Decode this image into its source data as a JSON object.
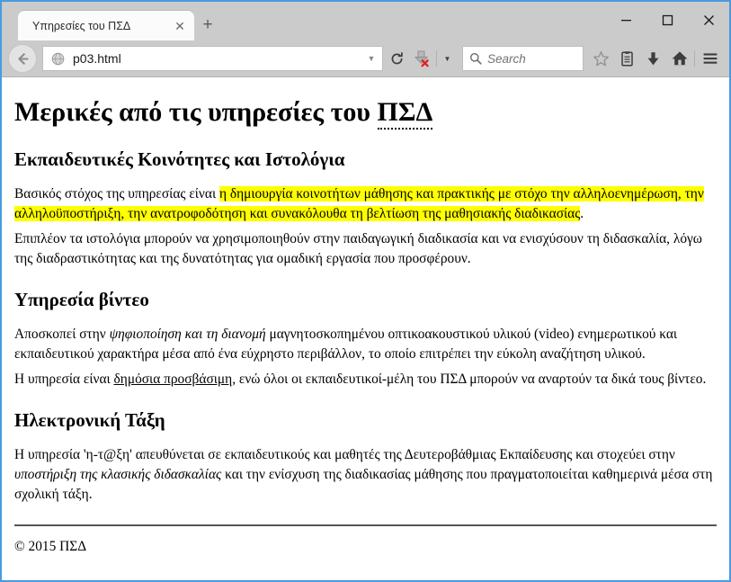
{
  "window": {
    "controls": {
      "minimize": "—",
      "maximize": "☐",
      "close": "✕"
    }
  },
  "tabs": [
    {
      "title": "Υπηρεσίες του ΠΣΔ",
      "close_label": "✕"
    }
  ],
  "newtab_label": "+",
  "toolbar": {
    "back_icon": "back-arrow-icon",
    "reload_icon": "reload-icon",
    "url": "p03.html",
    "url_dropdown_icon": "chevron-down-icon",
    "favicon": "globe-icon",
    "plugin_icon": "download-blocked-icon",
    "plugin_caret_icon": "chevron-down-icon",
    "search_placeholder": "Search",
    "search_icon": "search-icon",
    "bookmark_icon": "star-icon",
    "reader_icon": "reader-list-icon",
    "downloads_icon": "download-arrow-icon",
    "home_icon": "home-icon",
    "menu_icon": "hamburger-menu-icon"
  },
  "page": {
    "h1_before": "Μερικές από τις υπηρεσίες του ",
    "h1_abbr": "ΠΣΔ",
    "section1": {
      "heading": "Εκπαιδευτικές Κοινότητες και Ιστολόγια",
      "p1_before": "Βασικός στόχος της υπηρεσίας είναι ",
      "p1_mark": "η δημιουργία κοινοτήτων μάθησης και πρακτικής με στόχο την αλληλοενημέρωση, την αλληλοϋποστήριξη, την ανατροφοδότηση και συνακόλουθα τη βελτίωση της μαθησιακής διαδικασίας",
      "p1_after": ".",
      "p2": "Επιπλέον τα ιστολόγια μπορούν να χρησιμοποιηθούν στην παιδαγωγική διαδικασία και να ενισχύσουν τη διδασκαλία, λόγω της διαδραστικότητας και της δυνατότητας για ομαδική εργασία που προσφέρουν."
    },
    "section2": {
      "heading": "Υπηρεσία βίντεο",
      "p1_before": "Αποσκοπεί στην ",
      "p1_em": "ψηφιοποίηση και τη διανομή",
      "p1_after": " μαγνητοσκοπημένου οπτικοακουστικού υλικού (video) ενημερωτικού και εκπαιδευτικού χαρακτήρα μέσα από ένα εύχρηστο περιβάλλον, το οποίο επιτρέπει την εύκολη αναζήτηση υλικού.",
      "p2_before": "Η υπηρεσία είναι ",
      "p2_ins": "δημόσια προσβάσιμη",
      "p2_after": ", ενώ όλοι οι εκπαιδευτικοί-μέλη του ΠΣΔ μπορούν να αναρτούν τα δικά τους βίντεο."
    },
    "section3": {
      "heading": "Ηλεκτρονική Τάξη",
      "p1_before": "Η υπηρεσία 'η-τ@ξη' απευθύνεται σε εκπαιδευτικούς και μαθητές της Δευτεροβάθμιας Εκπαίδευσης και στοχεύει στην ",
      "p1_em": "υποστήριξη της κλασικής διδασκαλίας",
      "p1_after": " και την ενίσχυση της διαδικασίας μάθησης που πραγματοποιείται καθημερινά μέσα στη σχολική τάξη."
    },
    "footer": "© 2015 ΠΣΔ"
  },
  "colors": {
    "frame_border": "#4a9ae0",
    "chrome_bg": "#cbcbcb",
    "highlight": "#ffff00",
    "page_bg": "#ffffff"
  }
}
